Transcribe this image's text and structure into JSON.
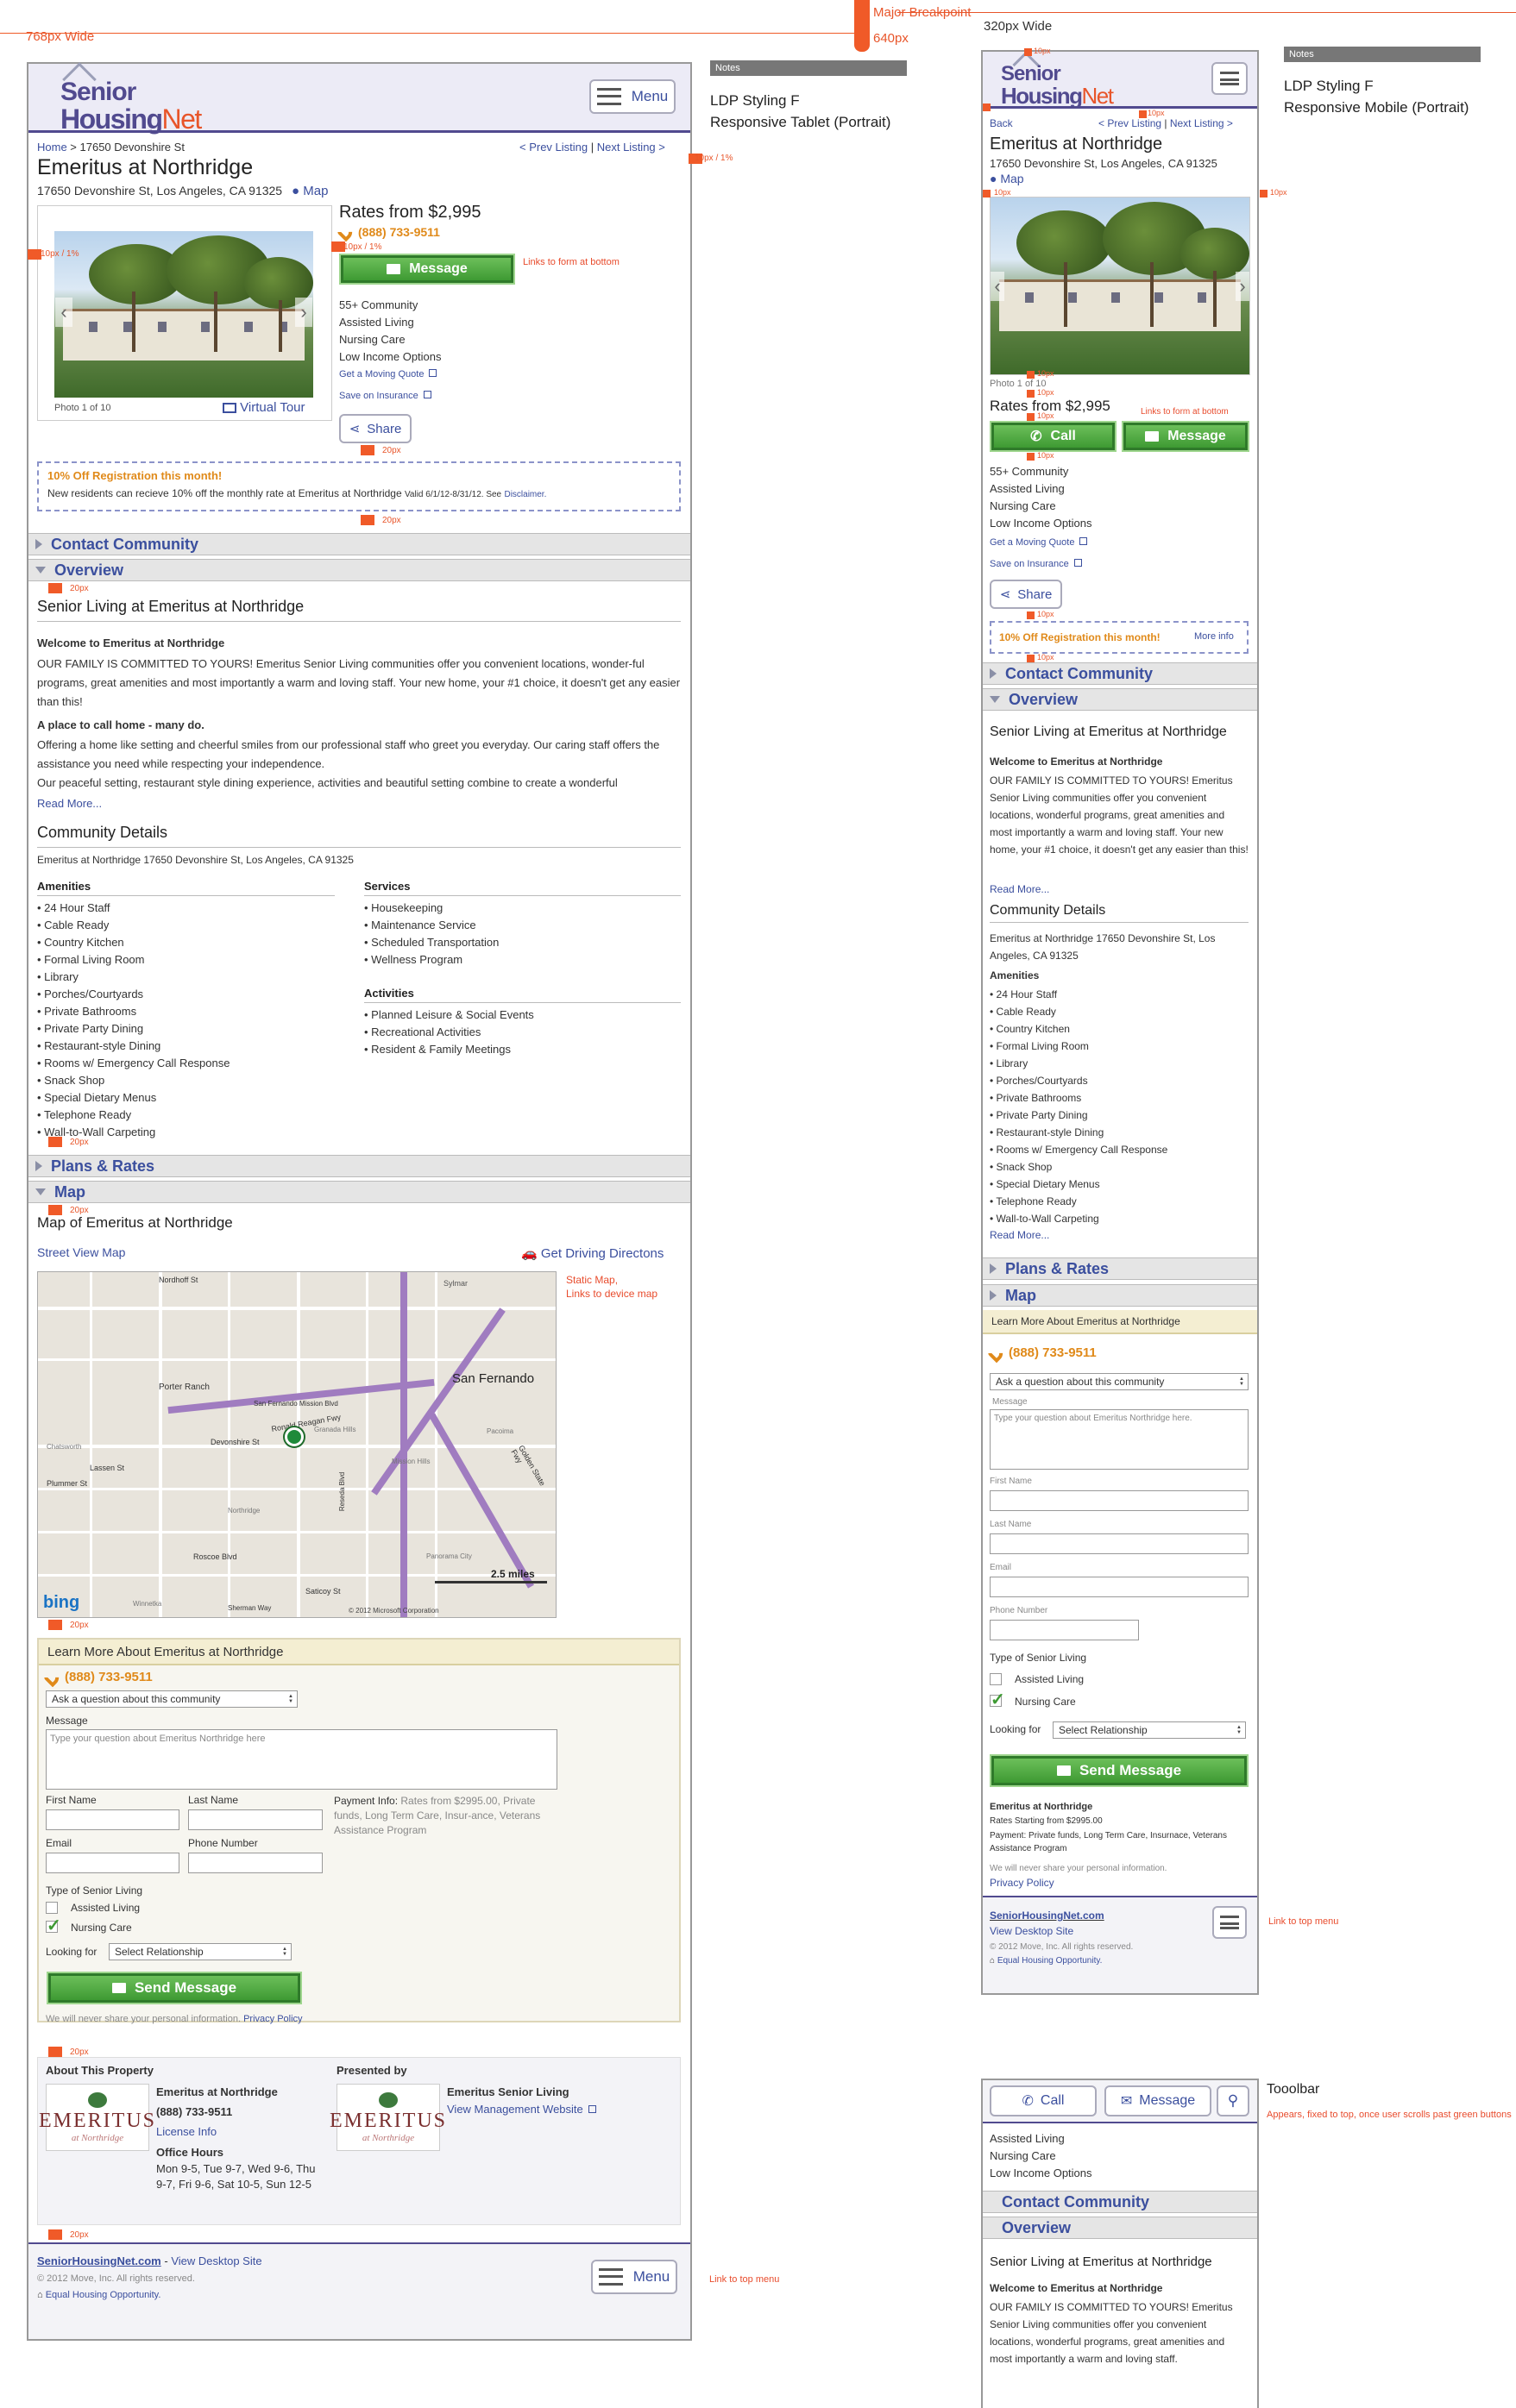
{
  "top": {
    "w768": "768px Wide",
    "w320": "320px Wide",
    "major": "Major Breakpoint",
    "p640": "640px"
  },
  "colors": {
    "accent": "#514a8f",
    "link": "#3b4f9e",
    "orange": "#e8552a",
    "green": "#3e9a33"
  },
  "header": {
    "logo_line1": "Senior",
    "logo_line2a": "Housing",
    "logo_line2b": "Net",
    "menu": "Menu"
  },
  "tablet": {
    "breadcrumb_home": "Home",
    "breadcrumb_sep": " > ",
    "breadcrumb_addr": "17650 Devonshire St",
    "prev": "< Prev  Listing",
    "next": "Next Listing >",
    "title": "Emeritus at Northridge",
    "address": "17650 Devonshire St, Los Angeles, CA 91325",
    "map": "Map",
    "rates": "Rates from $2,995",
    "phone": "(888) 733-9511",
    "message": "Message",
    "photo_count": "Photo 1 of 10",
    "virtual_tour": "Virtual Tour",
    "care": [
      "55+ Community",
      "Assisted Living",
      "Nursing Care",
      "Low Income Options"
    ],
    "moving_quote": "Get a Moving Quote",
    "insurance": "Save on Insurance",
    "share": "Share",
    "promo_title": "10% Off Registration this month!",
    "promo_text": "New residents can recieve 10% off the monthly rate at Emeritus at Northridge",
    "promo_valid": "Valid 6/1/12-8/31/12. See",
    "promo_disc": "Disclaimer.",
    "sec_contact": "Contact Community",
    "sec_overview": "Overview",
    "sec_plans": "Plans & Rates",
    "sec_map": "Map",
    "senior_living": "Senior Living at Emeritus at Northridge",
    "welcome": "Welcome to Emeritus at Northridge",
    "p1": "OUR FAMILY IS COMMITTED TO YOURS! Emeritus Senior Living communities offer you convenient locations, wonder-ful programs, great amenities and most importantly a warm and loving staff. Your new home, your #1 choice, it doesn't get any easier than this!",
    "home_head": "A place to call home - many do.",
    "p2": "Offering a home like setting and cheerful smiles from our professional staff who greet you everyday. Our caring staff offers the assistance you need while respecting your independence.",
    "p3": "Our peaceful setting, restaurant style dining experience, activities and beautiful setting combine to create a wonderful",
    "read_more": "Read More...",
    "comm_details": "Community Details",
    "comm_addr": "Emeritus at Northridge 17650 Devonshire St, Los Angeles, CA 91325",
    "amenities_h": "Amenities",
    "services_h": "Services",
    "activities_h": "Activities",
    "amenities": [
      "24 Hour Staff",
      "Cable Ready",
      "Country Kitchen",
      "Formal Living Room",
      "Library",
      "Porches/Courtyards",
      "Private Bathrooms",
      "Private Party Dining",
      "Restaurant-style Dining",
      "Rooms w/ Emergency Call Response",
      "Snack Shop",
      "Special Dietary Menus",
      "Telephone Ready",
      "Wall-to-Wall Carpeting"
    ],
    "services": [
      "Housekeeping",
      "Maintenance Service",
      "Scheduled Transportation",
      "Wellness Program"
    ],
    "activities": [
      "Planned Leisure & Social Events",
      "Recreational Activities",
      "Resident & Family Meetings"
    ],
    "map_of": "Map of Emeritus at Northridge",
    "street_view": "Street View Map",
    "directions": "Get Driving Directons",
    "map_labels": [
      "Nordhoff St",
      "Sylmar",
      "San Fernando",
      "Porter Ranch",
      "Ronald Reagan Fwy",
      "San Fernando Mission Blvd",
      "Devonshire St",
      "Granada Hills",
      "Chatsworth",
      "Lassen St",
      "Plummer St",
      "Northridge",
      "Roscoe Blvd",
      "Panorama City",
      "Saticoy St",
      "Sherman Way",
      "Winnetka",
      "Reseda Blvd",
      "Mission Hills",
      "Pacoima",
      "Golden State Fwy",
      "2.5 miles",
      "bing",
      "© 2012 Microsoft Corporation"
    ],
    "learn_more": "Learn More About Emeritus at Northridge",
    "ask": "Ask a question about this community",
    "msg_label": "Message",
    "msg_placeholder": "Type your question about Emeritus Northridge here",
    "first": "First Name",
    "last": "Last Name",
    "email": "Email",
    "phone_num": "Phone Number",
    "payment_label": "Payment Info:",
    "payment_text": "Rates from $2995.00, Private funds, Long Term Care, Insur-ance, Veterans Assistance Program",
    "type_living": "Type of Senior Living",
    "assisted": "Assisted Living",
    "nursing": "Nursing Care",
    "looking": "Looking for",
    "select_rel": "Select Relationship",
    "send": "Send Message",
    "never_share": "We will never share your personal information.",
    "privacy": "Privacy Policy",
    "about_prop": "About This Property",
    "presented_by": "Presented by",
    "prop_name": "Emeritus at Northridge",
    "license": "License Info",
    "office_hours": "Office Hours",
    "hours": "Mon 9-5, Tue 9-7, Wed 9-6, Thu 9-7, Fri 9-6, Sat 10-5, Sun 12-5",
    "presenter": "Emeritus Senior Living",
    "mgmt_site": "View Management Website",
    "emeritus_logo": "EMERITUS",
    "emeritus_sub": "at Northridge",
    "footer_site": "SeniorHousingNet.com",
    "footer_sep": " - ",
    "footer_desktop": "View Desktop Site",
    "copyright": "© 2012 Move, Inc. All rights reserved.",
    "equal": "Equal Housing Opportunity."
  },
  "mobile": {
    "back": "Back",
    "prev": "< Prev",
    "listing": "Listing",
    "next_listing": "Next Listing >",
    "title": "Emeritus at Northridge",
    "address": "17650 Devonshire St, Los Angeles, CA 91325",
    "map": "Map",
    "photo_count": "Photo 1 of 10",
    "rates": "Rates from $2,995",
    "call": "Call",
    "message": "Message",
    "care": [
      "55+ Community",
      "Assisted Living",
      "Nursing Care",
      "Low Income Options"
    ],
    "moving_quote": "Get a Moving Quote",
    "insurance": "Save on Insurance",
    "share": "Share",
    "promo_title": "10% Off Registration this month!",
    "more_info": "More info",
    "sec_contact": "Contact Community",
    "sec_overview": "Overview",
    "sec_plans": "Plans & Rates",
    "sec_map": "Map",
    "senior_living": "Senior Living at Emeritus at Northridge",
    "welcome": "Welcome to Emeritus at Northridge",
    "p1": "OUR FAMILY IS COMMITTED TO YOURS! Emeritus Senior Living communities offer you convenient locations, wonderful programs, great amenities and most importantly a warm and loving staff. Your new home, your #1 choice, it doesn't get any easier than this!",
    "read_more": "Read More...",
    "comm_details": "Community Details",
    "comm_addr": "Emeritus at Northridge 17650 Devonshire St, Los Angeles, CA 91325",
    "amenities_h": "Amenities",
    "amenities": [
      "24 Hour Staff",
      "Cable Ready",
      "Country Kitchen",
      "Formal Living Room",
      "Library",
      "Porches/Courtyards",
      "Private Bathrooms",
      "Private Party Dining",
      "Restaurant-style Dining",
      "Rooms w/ Emergency Call Response",
      "Snack Shop",
      "Special Dietary Menus",
      "Telephone Ready",
      "Wall-to-Wall Carpeting"
    ],
    "learn_more": "Learn More About Emeritus at Northridge",
    "phone": "(888) 733-9511",
    "ask": "Ask a question about this community",
    "msg_label": "Message",
    "msg_placeholder": "Type your question about Emeritus Northridge here.",
    "first": "First Name",
    "last": "Last Name",
    "email": "Email",
    "phone_num": "Phone Number",
    "type_living": "Type of Senior Living",
    "assisted": "Assisted Living",
    "nursing": "Nursing Care",
    "looking": "Looking for",
    "select_rel": "Select Relationship",
    "send": "Send Message",
    "prop_name": "Emeritus at Northridge",
    "rates_start": "Rates Starting from $2995.00",
    "payment": "Payment: Private funds, Long Term Care, Insurnace, Veterans Assistance Program",
    "never_share": "We will never share your personal information.",
    "privacy": "Privacy Policy",
    "footer_site": "SeniorHousingNet.com",
    "footer_desktop": "View Desktop Site",
    "copyright": "© 2012 Move, Inc. All rights reserved.",
    "equal": "Equal Housing Opportunity."
  },
  "toolbar": {
    "call": "Call",
    "message": "Message",
    "label": "Tooolbar",
    "note": "Appears, fixed to top, once user scrolls past green buttons",
    "care": [
      "Assisted Living",
      "Nursing Care",
      "Low Income Options"
    ],
    "contact": "Contact Community",
    "overview": "Overview",
    "senior_living": "Senior Living at Emeritus at Northridge",
    "welcome": "Welcome to Emeritus at Northridge",
    "p1": "OUR FAMILY IS COMMITTED TO YOURS! Emeritus Senior Living communities offer you convenient locations, wonderful programs, great amenities and most importantly a warm and loving staff."
  },
  "notes": {
    "label": "Notes",
    "t1a": "LDP Styling F",
    "t1b": "Responsive Tablet (Portrait)",
    "t2a": "LDP Styling F",
    "t2b": "Responsive Mobile (Portrait)"
  },
  "annotations": {
    "m10_1": "10px / 1%",
    "m10": "10px",
    "m20": "20px",
    "links_form": "Links to form at bottom",
    "static_map": "Static Map,\nLinks to device map",
    "link_top": "Link to top menu"
  }
}
